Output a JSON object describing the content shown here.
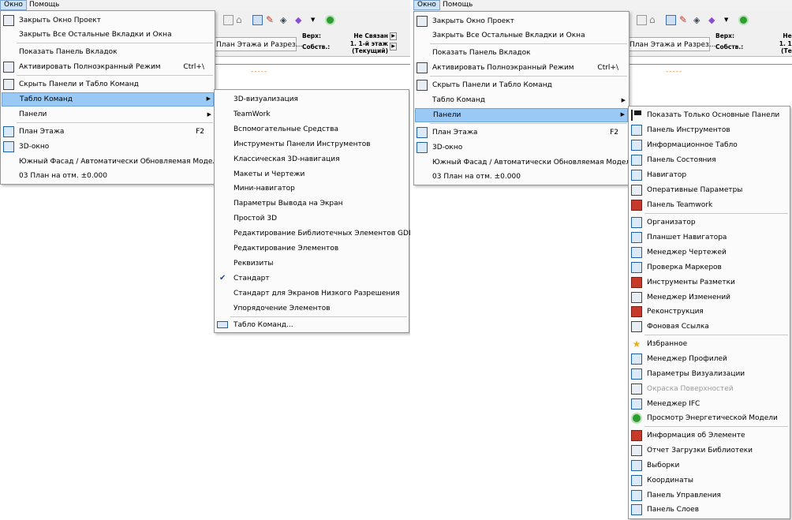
{
  "menubar": {
    "window": "Окно",
    "help": "Помощь"
  },
  "toolbar": {
    "combo_label": "План Этажа и Разрез...",
    "infobox": {
      "top_label": "Верх:",
      "top_value": "Не Связан",
      "own_label": "Собств.:",
      "own_value_1": "1. 1-й этаж",
      "own_value_2": "(Текущий)"
    },
    "hatch": "-----"
  },
  "window_menu": {
    "items": [
      {
        "label": "Закрыть Окно Проект"
      },
      {
        "label": "Закрыть Все Остальные Вкладки и Окна"
      },
      {
        "label": "Показать Панель Вкладок"
      },
      {
        "label": "Активировать Полноэкранный Режим",
        "shortcut": "Ctrl+\\"
      },
      {
        "label": "Скрыть Панели и Табло Команд"
      },
      {
        "label": "Табло Команд",
        "arrow": "▶"
      },
      {
        "label": "Панели",
        "arrow": "▶"
      },
      {
        "label": "План Этажа",
        "shortcut": "F2"
      },
      {
        "label": "3D-окно"
      },
      {
        "label": "Южный Фасад / Автоматически Обновляемая Модель"
      },
      {
        "label": "03 План на отм. ±0.000"
      }
    ]
  },
  "toolbars_submenu": {
    "items": [
      "3D-визуализация",
      "TeamWork",
      "Вспомогательные Средства",
      "Инструменты Панели Инструментов",
      "Классическая 3D-навигация",
      "Макеты и Чертежи",
      "Мини-навигатор",
      "Параметры Вывода на Экран",
      "Простой 3D",
      "Редактирование Библиотечных Элементов GDL",
      "Редактирование Элементов",
      "Реквизиты",
      "Стандарт",
      "Стандарт для Экранов Низкого Разрешения",
      "Упорядочение Элементов"
    ],
    "checked_item": "Стандарт",
    "checkmark": "✔",
    "footer": "Табло Команд..."
  },
  "palettes_submenu": {
    "items": [
      {
        "label": "Показать Только Основные Панели"
      },
      {
        "label": "Панель Инструментов"
      },
      {
        "label": "Информационное Табло"
      },
      {
        "label": "Панель Состояния"
      },
      {
        "label": "Навигатор"
      },
      {
        "label": "Оперативные Параметры"
      },
      {
        "label": "Панель Teamwork"
      },
      {
        "label": "Организатор"
      },
      {
        "label": "Планшет Навигатора"
      },
      {
        "label": "Менеджер Чертежей"
      },
      {
        "label": "Проверка Маркеров"
      },
      {
        "label": "Инструменты Разметки"
      },
      {
        "label": "Менеджер Изменений"
      },
      {
        "label": "Реконструкция"
      },
      {
        "label": "Фоновая Ссылка"
      },
      {
        "label": "Избранное"
      },
      {
        "label": "Менеджер Профилей"
      },
      {
        "label": "Параметры Визуализации"
      },
      {
        "label": "Окраска Поверхностей",
        "disabled": true
      },
      {
        "label": "Менеджер IFC"
      },
      {
        "label": "Просмотр Энергетической Модели"
      },
      {
        "label": "Информация об Элементе"
      },
      {
        "label": "Отчет Загрузки Библиотеки"
      },
      {
        "label": "Выборки"
      },
      {
        "label": "Координаты"
      },
      {
        "label": "Панель Управления"
      },
      {
        "label": "Панель Слоев"
      }
    ]
  },
  "colors": {
    "highlight": "#99c9f4",
    "menu_bg": "#fbfbfb",
    "toolbar_bg": "#f0f0f0"
  }
}
